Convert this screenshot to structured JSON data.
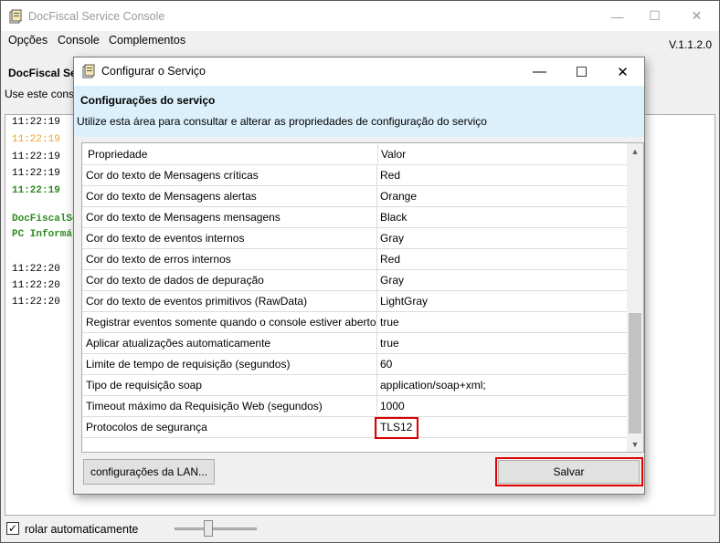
{
  "main": {
    "title": "DocFiscal Service Console",
    "menu": [
      "Opções",
      "Console",
      "Complementos"
    ],
    "version": "V.1.1.2.0",
    "header_title": "DocFiscal Ser",
    "header_sub": "Use este conso",
    "log": [
      {
        "text": "11:22:19",
        "color": "#000000"
      },
      {
        "text": "11:22:19",
        "color": "#f0a030"
      },
      {
        "text": "11:22:19",
        "color": "#000000"
      },
      {
        "text": "11:22:19",
        "color": "#000000"
      },
      {
        "text": "11:22:19",
        "color": "#2e8b22"
      },
      {
        "text": "DocFiscalSe",
        "color": "#2e8b22"
      },
      {
        "text": "PC Informát",
        "color": "#2e8b22"
      },
      {
        "text": "11:22:20",
        "color": "#000000"
      },
      {
        "text": "11:22:20",
        "color": "#000000"
      },
      {
        "text": "11:22:20",
        "color": "#000000"
      }
    ],
    "autoscroll_label": "rolar automaticamente",
    "autoscroll_checked": true
  },
  "dialog": {
    "title": "Configurar o Serviço",
    "head_title": "Configurações do serviço",
    "head_sub": "Utilize esta área para consultar e alterar as propriedades de configuração do serviço",
    "col_property": "Propriedade",
    "col_value": "Valor",
    "rows": [
      {
        "name": "Cor do texto de Mensagens críticas",
        "value": "Red"
      },
      {
        "name": "Cor do texto de Mensagens alertas",
        "value": "Orange"
      },
      {
        "name": "Cor do texto de Mensagens mensagens",
        "value": "Black"
      },
      {
        "name": "Cor do texto de eventos internos",
        "value": "Gray"
      },
      {
        "name": "Cor do texto de erros internos",
        "value": "Red"
      },
      {
        "name": "Cor do texto de dados de depuração",
        "value": "Gray"
      },
      {
        "name": "Cor do texto de eventos primitivos (RawData)",
        "value": "LightGray"
      },
      {
        "name": "Registrar eventos somente quando o console estiver aberto",
        "value": "true"
      },
      {
        "name": "Aplicar atualizações automaticamente",
        "value": "true"
      },
      {
        "name": "Limite de tempo de requisição (segundos)",
        "value": "60"
      },
      {
        "name": "Tipo de requisição soap",
        "value": "application/soap+xml;"
      },
      {
        "name": "Timeout máximo da Requisição Web (segundos)",
        "value": "1000"
      },
      {
        "name": "Protocolos de segurança",
        "value": "TLS12"
      }
    ],
    "lan_button": "configurações da LAN...",
    "save_button": "Salvar",
    "highlight_color": "#e00000"
  }
}
